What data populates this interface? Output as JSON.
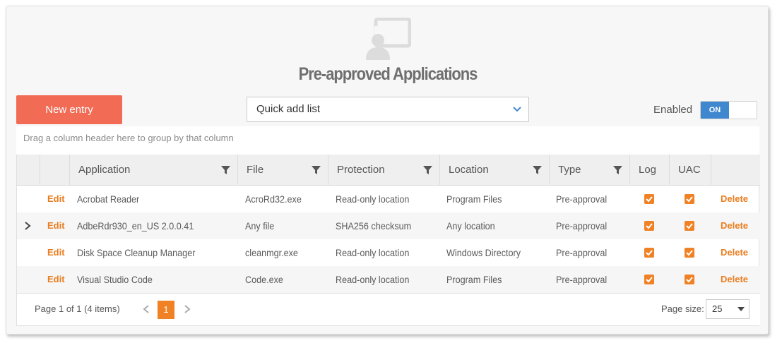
{
  "page": {
    "title": "Pre-approved Applications",
    "hero_icon": "remote-desktop-user-icon"
  },
  "toolbar": {
    "new_entry_label": "New entry",
    "quick_add_value": "Quick add list",
    "enabled_label": "Enabled",
    "toggle_state": "ON"
  },
  "grid": {
    "group_hint": "Drag a column header here to group by that column",
    "columns": [
      "Application",
      "File",
      "Protection",
      "Location",
      "Type",
      "Log",
      "UAC"
    ],
    "rows": [
      {
        "edit": "Edit",
        "application": "Acrobat Reader",
        "file": "AcroRd32.exe",
        "protection": "Read-only location",
        "location": "Program Files",
        "type": "Pre-approval",
        "log": true,
        "uac": true,
        "delete": "Delete",
        "expandable": false
      },
      {
        "edit": "Edit",
        "application": "AdbeRdr930_en_US 2.0.0.41",
        "file": "Any file",
        "protection": "SHA256 checksum",
        "location": "Any location",
        "type": "Pre-approval",
        "log": true,
        "uac": true,
        "delete": "Delete",
        "expandable": true
      },
      {
        "edit": "Edit",
        "application": "Disk Space Cleanup Manager",
        "file": "cleanmgr.exe",
        "protection": "Read-only location",
        "location": "Windows Directory",
        "type": "Pre-approval",
        "log": true,
        "uac": true,
        "delete": "Delete",
        "expandable": false
      },
      {
        "edit": "Edit",
        "application": "Visual Studio Code",
        "file": "Code.exe",
        "protection": "Read-only location",
        "location": "Program Files",
        "type": "Pre-approval",
        "log": true,
        "uac": true,
        "delete": "Delete",
        "expandable": false
      }
    ]
  },
  "pager": {
    "info": "Page 1 of 1 (4 items)",
    "current_page": "1",
    "page_size_label": "Page size:",
    "page_size_value": "25"
  },
  "colors": {
    "accent": "#f08125",
    "new_button": "#f26b55",
    "toggle_on": "#3f87cf"
  }
}
